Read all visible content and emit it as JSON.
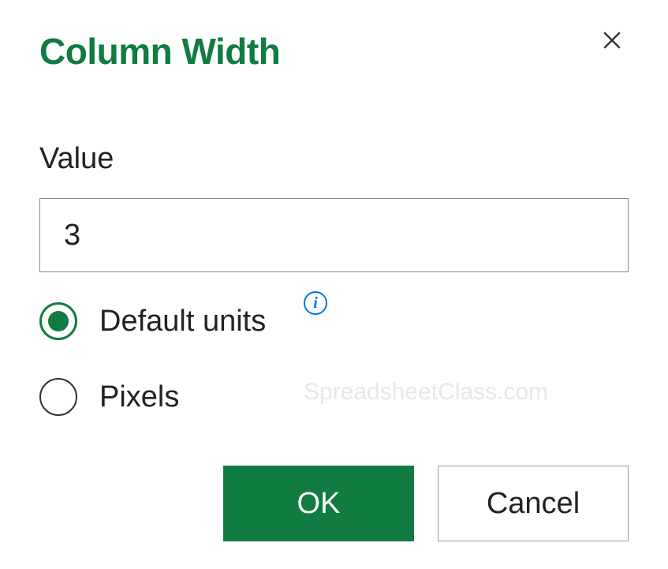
{
  "dialog": {
    "title": "Column Width",
    "field_label": "Value",
    "input_value": "3",
    "radios": {
      "default_units": "Default units",
      "pixels": "Pixels"
    },
    "selected_radio": "default_units",
    "buttons": {
      "ok": "OK",
      "cancel": "Cancel"
    }
  },
  "watermark": "SpreadsheetClass.com",
  "colors": {
    "accent": "#107c41",
    "info": "#0078d4"
  }
}
